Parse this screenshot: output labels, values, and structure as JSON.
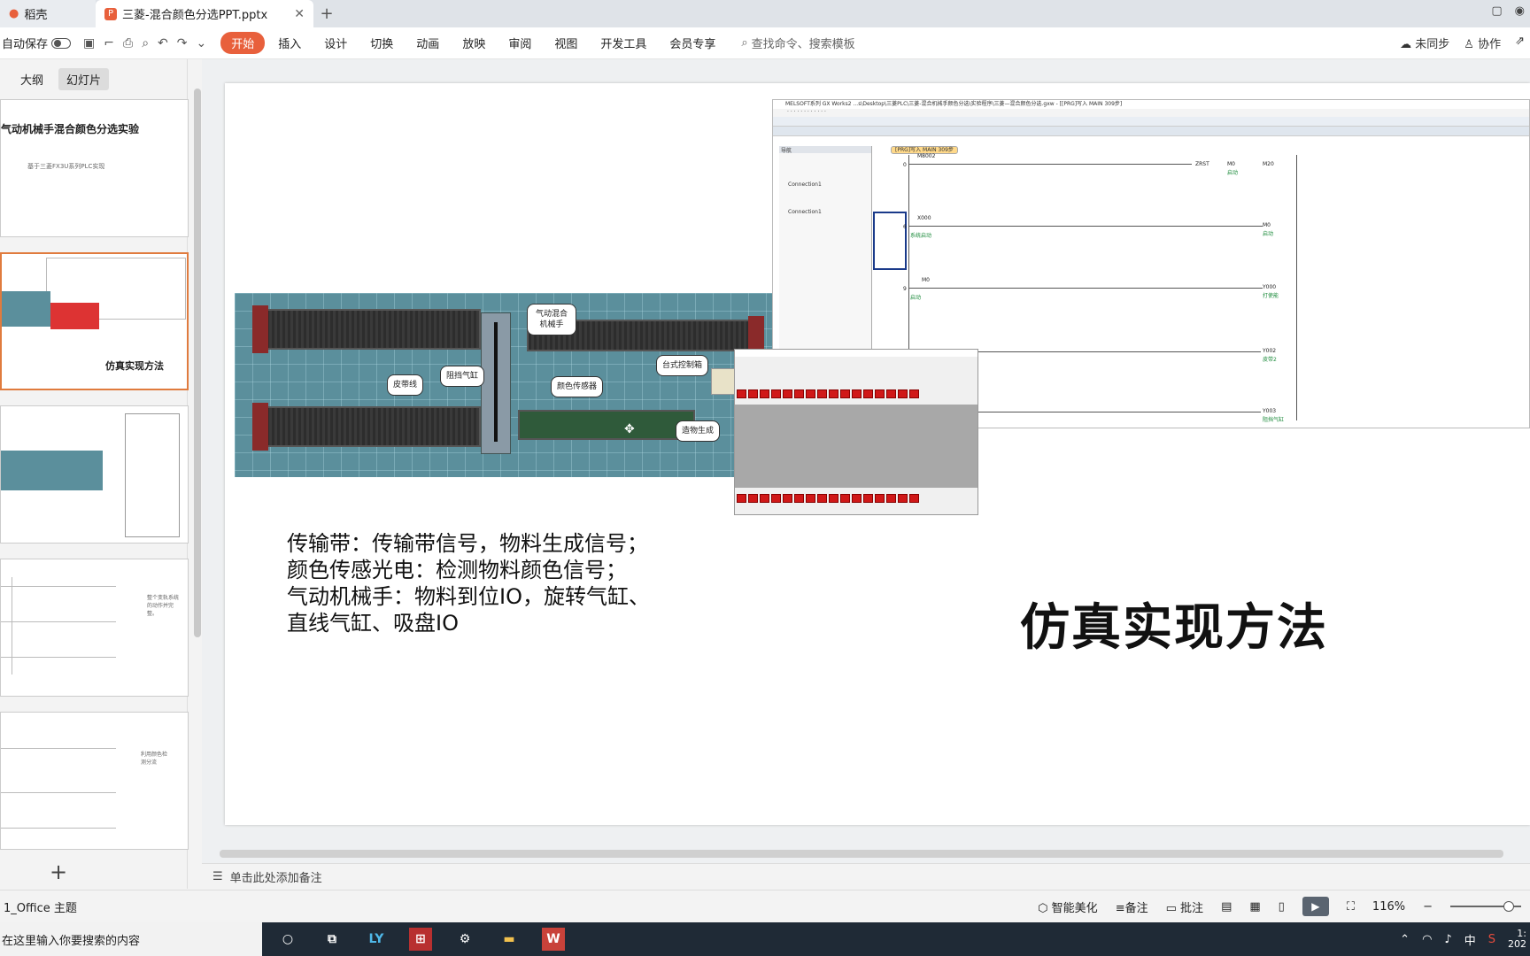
{
  "tabs": {
    "home": "稻壳",
    "doc": "三菱-混合颜色分选PPT.pptx"
  },
  "toolbar": {
    "autosave": "自动保存",
    "start": "开始",
    "menus": [
      "插入",
      "设计",
      "切换",
      "动画",
      "放映",
      "审阅",
      "视图",
      "开发工具",
      "会员专享"
    ],
    "search": "查找命令、搜索模板",
    "sync": "未同步",
    "collab": "协作"
  },
  "panel": {
    "outline": "大纲",
    "slides": "幻灯片"
  },
  "thumbs": {
    "t1_title": "气动机械手混合颜色分选实验",
    "t1_sub": "基于三菱FX3U系列PLC实现",
    "t2_title": "仿真实现方法",
    "t4_text": "整个变轨系统的动作并完整。",
    "t5_text": "利用颜色检测分流"
  },
  "sim": {
    "labels": {
      "arm": "气动混合机械手",
      "belt": "皮带线",
      "cylinder": "阻挡气缸",
      "sensor": "颜色传感器",
      "cabinet": "台式控制箱",
      "gen": "造物生成"
    }
  },
  "gx": {
    "title": "MELSOFT系列 GX Works2 ...s\\Desktop\\三菱PLC\\三菱-混合机械手颜色分选\\实验程序\\三菱—混合颜色分选.gxw - [[PRG]写入 MAIN 309步]",
    "ptab": "[PRG]写入 MAIN 309步",
    "nav": "导航",
    "conn1": "Connection1",
    "r1": "M8002",
    "r1o": "ZRST",
    "r1a": "M0",
    "r1b": "M20",
    "r1c": "启动",
    "r2": "X000",
    "r2n": "系统启动",
    "r2o": "M0",
    "r2c": "启动",
    "r3": "M0",
    "r3n": "启动",
    "r3o": "Y000",
    "r3c": "打使能",
    "r4o": "Y002",
    "r4c": "皮带2",
    "r5o": "Y003",
    "r5c": "阻挡气缸",
    "n0": "0",
    "n6": "6",
    "n9": "9"
  },
  "slide": {
    "line1": "传输带：传输带信号，物料生成信号；",
    "line2": "颜色传感光电：检测物料颜色信号；",
    "line3": "气动机械手：物料到位IO，旋转气缸、",
    "line4": "直线气缸、吸盘IO",
    "title": "仿真实现方法"
  },
  "notes": "单击此处添加备注",
  "status": {
    "theme": "1_Office 主题",
    "beautify": "智能美化",
    "notes": "备注",
    "comment": "批注",
    "zoom": "116%"
  },
  "taskbar": {
    "search": "在这里输入你要搜索的内容",
    "ime": "中",
    "time": "1:",
    "date": "202"
  }
}
